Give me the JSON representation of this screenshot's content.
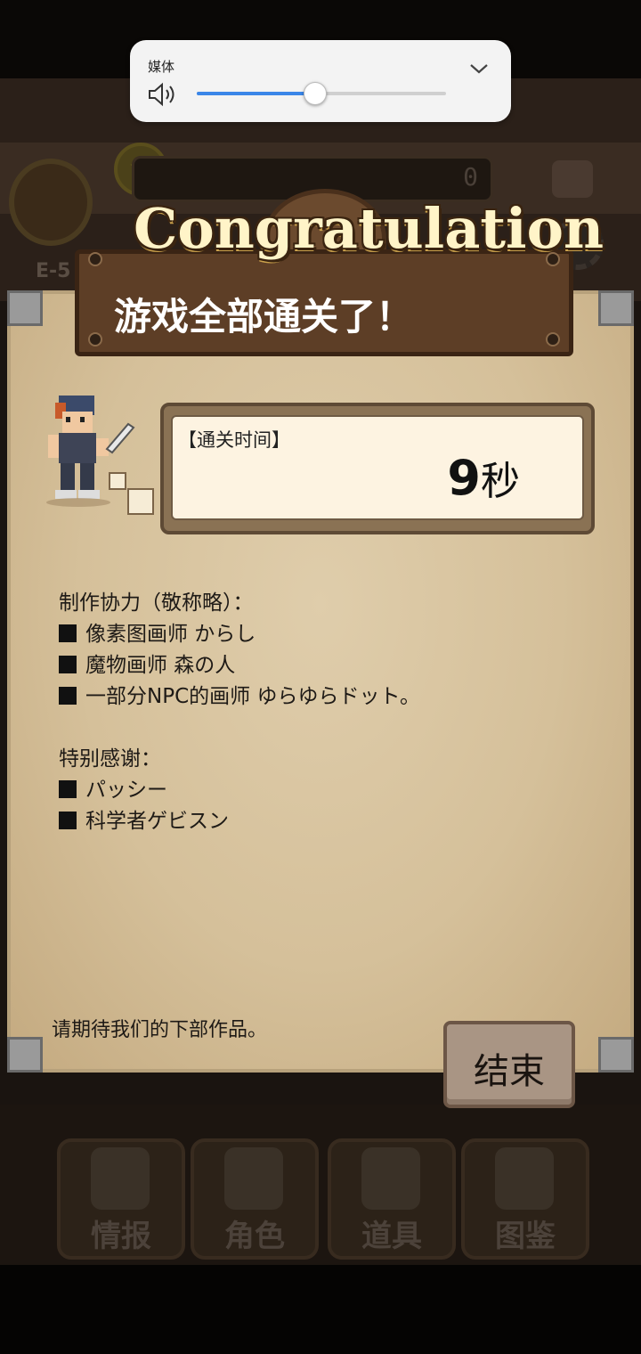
{
  "volume_popup": {
    "title": "媒体",
    "level_percent": 47,
    "accent_color": "#3a86e8",
    "icons": [
      "speaker-icon",
      "chevron-down-icon"
    ]
  },
  "background_hud": {
    "currency_value": "0",
    "stage_label": "E-5"
  },
  "bottom_nav": {
    "items": [
      {
        "label": "情报",
        "icon": "info-person-icon"
      },
      {
        "label": "角色",
        "icon": "character-cards-icon"
      },
      {
        "label": "道具",
        "icon": "treasure-chest-icon"
      },
      {
        "label": "图鉴",
        "icon": "book-question-icon"
      }
    ]
  },
  "dialog": {
    "banner_text": "Congratulation",
    "title": "游戏全部通关了！",
    "clear_time": {
      "label": "【通关时间】",
      "value": "9",
      "unit": "秒"
    },
    "credits_header": "制作协力（敬称略）：",
    "credits": [
      "像素图画师 からし",
      "魔物画师 森の人",
      "一部分NPC的画师 ゆらゆらドット。"
    ],
    "thanks_header": "特别感谢：",
    "thanks": [
      "パッシー",
      "科学者ゲビスン"
    ],
    "closing": "请期待我们的下部作品。",
    "end_button": "结束"
  }
}
